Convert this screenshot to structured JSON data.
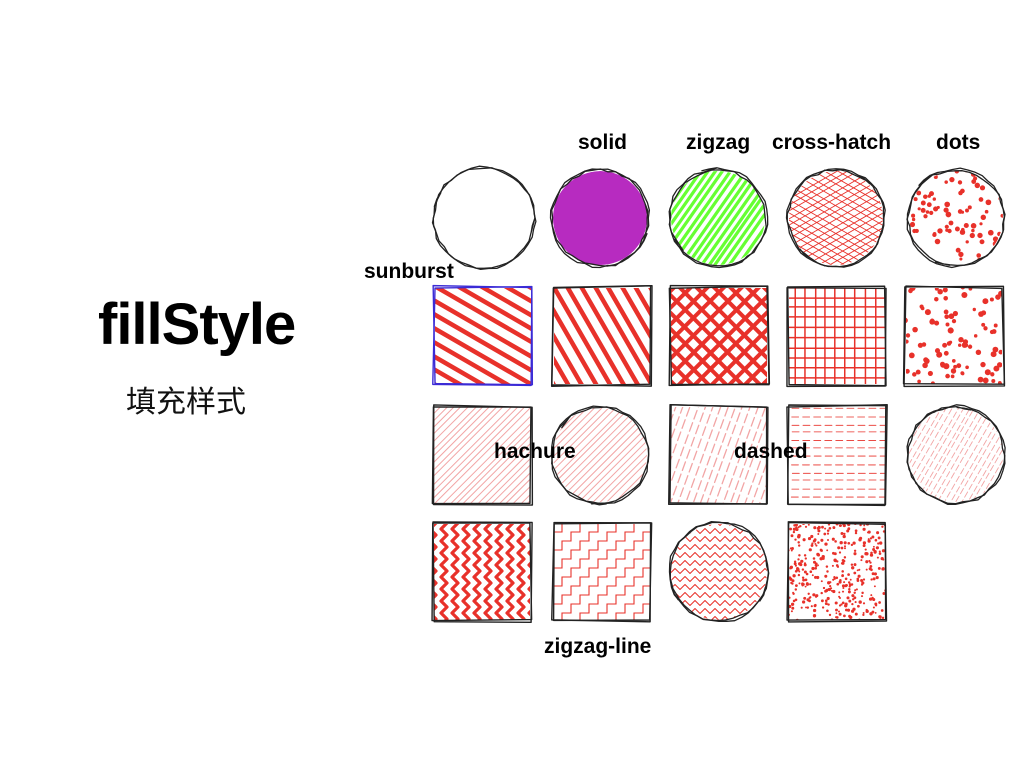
{
  "title": "fillStyle",
  "subtitle": "填充样式",
  "labels": {
    "solid": "solid",
    "zigzag": "zigzag",
    "cross_hatch": "cross-hatch",
    "dots": "dots",
    "sunburst": "sunburst",
    "hachure": "hachure",
    "dashed": "dashed",
    "zigzag_line": "zigzag-line"
  },
  "colors": {
    "stroke": "#222222",
    "fill_red": "#e8312a",
    "fill_pink": "#f2a5a5",
    "solid_purple": "#b72bc0",
    "zigzag_green": "#66ff33",
    "highlight_blue": "#3b2bd6"
  }
}
